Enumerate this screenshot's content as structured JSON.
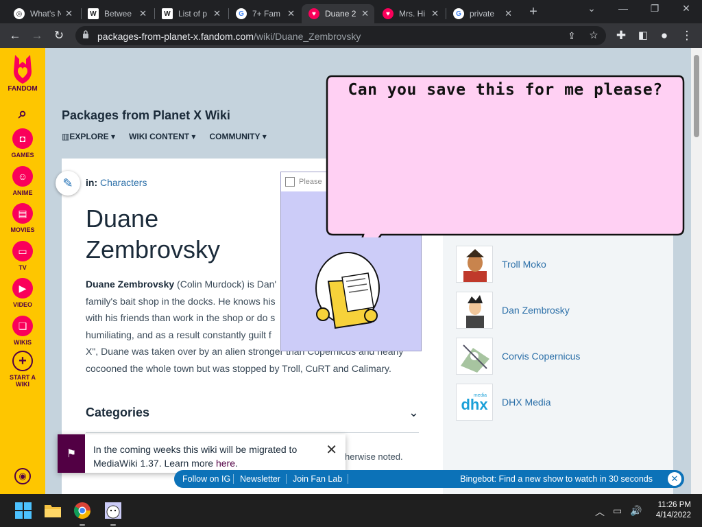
{
  "browser": {
    "tabs": [
      {
        "title": "What's N",
        "icon": "chatgpt-icon"
      },
      {
        "title": "Betwee",
        "icon": "wikipedia-icon"
      },
      {
        "title": "List of p",
        "icon": "wikipedia-icon"
      },
      {
        "title": "7+ Fam",
        "icon": "google-icon"
      },
      {
        "title": "Duane 2",
        "icon": "fandom-icon"
      },
      {
        "title": "Mrs. Hi",
        "icon": "fandom-icon"
      },
      {
        "title": "private",
        "icon": "google-icon"
      }
    ],
    "active_tab_index": 4,
    "url_domain": "packages-from-planet-x.fandom.com",
    "url_path": "/wiki/Duane_Zembrovsky"
  },
  "rail": {
    "brand": "FANDOM",
    "items": [
      {
        "label": "GAMES",
        "icon": "gamepad-icon"
      },
      {
        "label": "ANIME",
        "icon": "anime-face-icon"
      },
      {
        "label": "MOVIES",
        "icon": "clapperboard-icon"
      },
      {
        "label": "TV",
        "icon": "tv-icon"
      },
      {
        "label": "VIDEO",
        "icon": "play-icon"
      },
      {
        "label": "WIKIS",
        "icon": "book-icon"
      }
    ],
    "start_wiki_line1": "START A",
    "start_wiki_line2": "WIKI"
  },
  "wiki": {
    "name": "Packages from Planet X Wiki",
    "nav": [
      "EXPLORE",
      "WIKI CONTENT",
      "COMMUNITY"
    ]
  },
  "article": {
    "in_label": "in:",
    "category": "Characters",
    "title_line1": "Duane",
    "title_line2": "Zembrovsky",
    "lead_bold": "Duane Zembrovsky",
    "lines": [
      " (Colin Murdock) is Dan'",
      "family's bait shop in the docks. He knows his",
      "with his friends than work in the shop or do s",
      "humiliating, and as a result constantly guilt f",
      "X\", Duane was taken over by an alien stronger than Copernicus and nearly",
      "cocooned the whole town but was stopped by Troll, CuRT and Calimary."
    ],
    "categories_heading": "Categories",
    "otherwise": "herwise noted."
  },
  "related": [
    {
      "name": "Troll Moko"
    },
    {
      "name": "Dan Zembrosky"
    },
    {
      "name": "Corvis Copernicus"
    },
    {
      "name": "DHX Media",
      "logo_text": "dhx",
      "logo_small": "media"
    }
  ],
  "popup": {
    "title": "Please",
    "bubble_text": "Can you save this for me please?"
  },
  "toast": {
    "line1": "In the coming weeks this wiki will be migrated to",
    "line2_prefix": "MediaWiki 1.37. Learn more ",
    "link": "here",
    "suffix": "."
  },
  "bluebar": {
    "links": [
      "Follow on IG",
      "Newsletter",
      "Join Fan Lab"
    ],
    "bingebot": "Bingebot: Find a new show to watch in 30 seconds"
  },
  "taskbar": {
    "time": "11:26 PM",
    "date": "4/14/2022"
  },
  "colors": {
    "fandom_yellow": "#fec600",
    "fandom_pink": "#fa005a",
    "fandom_purple": "#520044",
    "link_blue": "#2b6fa8",
    "bar_blue": "#0c72b8"
  }
}
